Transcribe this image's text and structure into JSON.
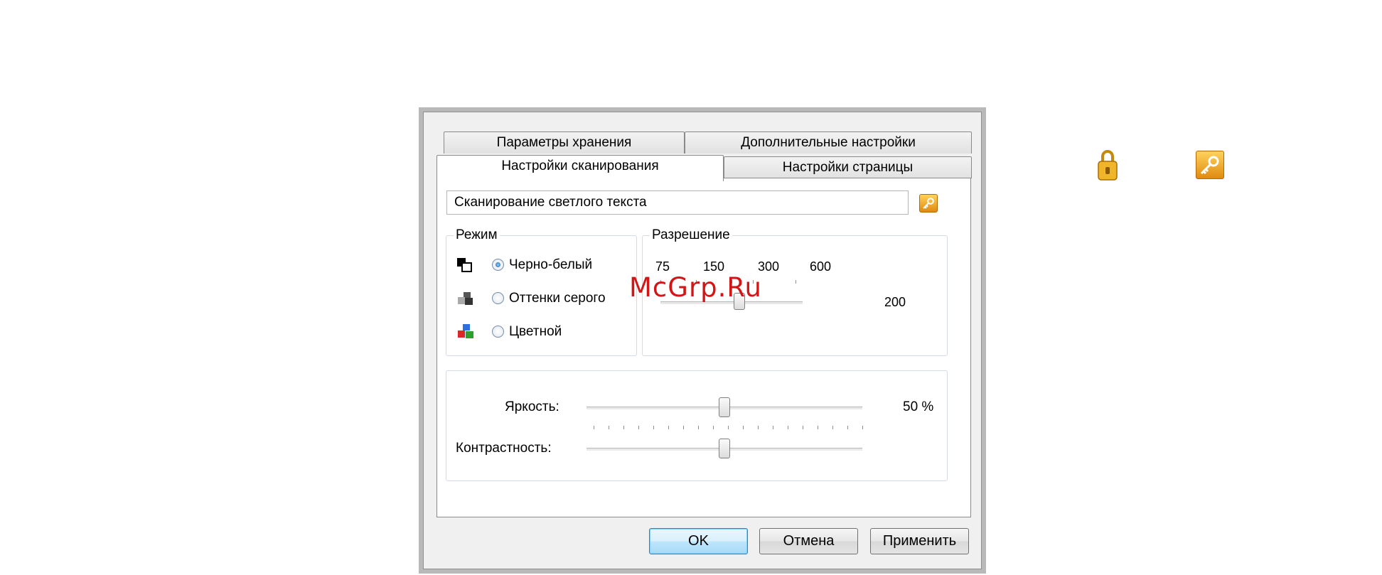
{
  "tabs": {
    "storage": "Параметры хранения",
    "advanced": "Дополнительные настройки",
    "scan": "Настройки сканирования",
    "page": "Настройки страницы"
  },
  "profile": {
    "value": "Сканирование светлого текста"
  },
  "mode": {
    "title": "Режим",
    "options": [
      {
        "label": "Черно-белый",
        "checked": true
      },
      {
        "label": "Оттенки серого",
        "checked": false
      },
      {
        "label": "Цветной",
        "checked": false
      }
    ]
  },
  "resolution": {
    "title": "Разрешение",
    "scale_labels": [
      "75",
      "150",
      "300",
      "600"
    ],
    "value": "200",
    "fraction": 0.42
  },
  "brightness": {
    "label": "Яркость:",
    "value": "50 %",
    "fraction": 0.5
  },
  "contrast": {
    "label": "Контрастность:",
    "fraction": 0.5
  },
  "buttons": {
    "ok": "OK",
    "cancel": "Отмена",
    "apply": "Применить"
  },
  "watermark": "McGrp.Ru",
  "colors": {
    "accent": "#3c7fb1",
    "key_icon": "#f0a020",
    "watermark": "#d31515"
  }
}
